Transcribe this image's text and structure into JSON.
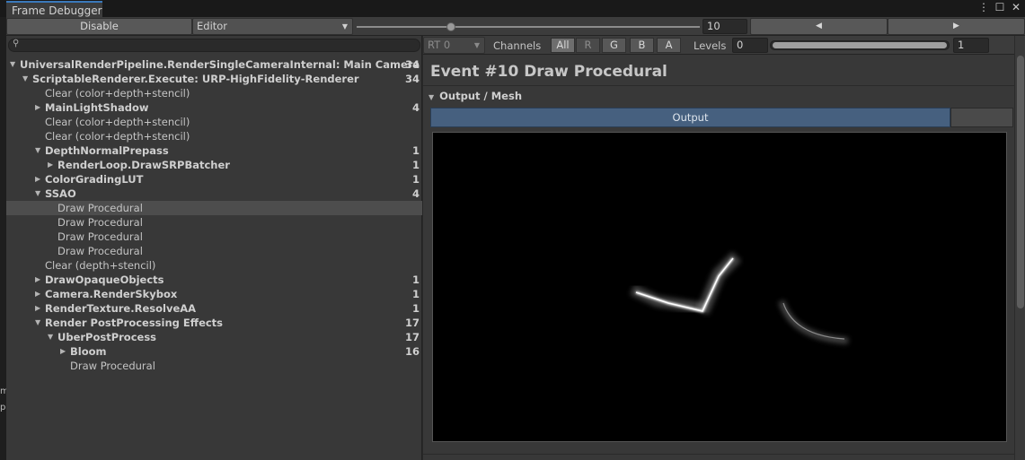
{
  "window": {
    "tab_title": "Frame Debugger",
    "menu_icon": "kebab-menu-icon",
    "maximize_icon": "maximize-icon",
    "close_icon": "close-icon"
  },
  "toolbar": {
    "disable_label": "Disable",
    "target_dropdown": "Editor",
    "event_slider_value": 10,
    "event_number": "10",
    "prev_icon": "triangle-left-icon",
    "next_icon": "triangle-right-icon"
  },
  "left_edge_fragments": [
    "m",
    "p"
  ],
  "hierarchy": {
    "search_placeholder": "",
    "rows": [
      {
        "label": "UniversalRenderPipeline.RenderSingleCameraInternal: Main Camera",
        "count": "34",
        "depth": 0,
        "expander": "expanded",
        "bold": true
      },
      {
        "label": "ScriptableRenderer.Execute: URP-HighFidelity-Renderer",
        "count": "34",
        "depth": 1,
        "expander": "expanded",
        "bold": true
      },
      {
        "label": "Clear (color+depth+stencil)",
        "count": "",
        "depth": 2,
        "expander": "none",
        "bold": false
      },
      {
        "label": "MainLightShadow",
        "count": "4",
        "depth": 2,
        "expander": "collapsed",
        "bold": true
      },
      {
        "label": "Clear (color+depth+stencil)",
        "count": "",
        "depth": 2,
        "expander": "none",
        "bold": false
      },
      {
        "label": "Clear (color+depth+stencil)",
        "count": "",
        "depth": 2,
        "expander": "none",
        "bold": false
      },
      {
        "label": "DepthNormalPrepass",
        "count": "1",
        "depth": 2,
        "expander": "expanded",
        "bold": true
      },
      {
        "label": "RenderLoop.DrawSRPBatcher",
        "count": "1",
        "depth": 3,
        "expander": "collapsed",
        "bold": true
      },
      {
        "label": "ColorGradingLUT",
        "count": "1",
        "depth": 2,
        "expander": "collapsed",
        "bold": true
      },
      {
        "label": "SSAO",
        "count": "4",
        "depth": 2,
        "expander": "expanded",
        "bold": true
      },
      {
        "label": "Draw Procedural",
        "count": "",
        "depth": 3,
        "expander": "none",
        "bold": false,
        "selected": true
      },
      {
        "label": "Draw Procedural",
        "count": "",
        "depth": 3,
        "expander": "none",
        "bold": false
      },
      {
        "label": "Draw Procedural",
        "count": "",
        "depth": 3,
        "expander": "none",
        "bold": false
      },
      {
        "label": "Draw Procedural",
        "count": "",
        "depth": 3,
        "expander": "none",
        "bold": false
      },
      {
        "label": "Clear (depth+stencil)",
        "count": "",
        "depth": 2,
        "expander": "none",
        "bold": false
      },
      {
        "label": "DrawOpaqueObjects",
        "count": "1",
        "depth": 2,
        "expander": "collapsed",
        "bold": true
      },
      {
        "label": "Camera.RenderSkybox",
        "count": "1",
        "depth": 2,
        "expander": "collapsed",
        "bold": true
      },
      {
        "label": "RenderTexture.ResolveAA",
        "count": "1",
        "depth": 2,
        "expander": "collapsed",
        "bold": true
      },
      {
        "label": "Render PostProcessing Effects",
        "count": "17",
        "depth": 2,
        "expander": "expanded",
        "bold": true
      },
      {
        "label": "UberPostProcess",
        "count": "17",
        "depth": 3,
        "expander": "expanded",
        "bold": true
      },
      {
        "label": "Bloom",
        "count": "16",
        "depth": 4,
        "expander": "collapsed",
        "bold": true
      },
      {
        "label": "Draw Procedural",
        "count": "",
        "depth": 4,
        "expander": "none",
        "bold": false
      }
    ]
  },
  "render_target": {
    "rt_dropdown": "RT 0",
    "channels_label": "Channels",
    "channels": [
      {
        "label": "All",
        "state": "active"
      },
      {
        "label": "R",
        "state": "dim"
      },
      {
        "label": "G",
        "state": "normal"
      },
      {
        "label": "B",
        "state": "normal"
      },
      {
        "label": "A",
        "state": "normal"
      }
    ],
    "levels_label": "Levels",
    "levels_min": "0",
    "levels_max": "1",
    "levels_slider_fraction": 1.0
  },
  "details": {
    "event_title": "Event #10 Draw Procedural",
    "section_title": "Output / Mesh",
    "output_tab_label": "Output"
  },
  "colors": {
    "selection_row": "#4d4d4d",
    "output_tab": "#46607f",
    "tab_highlight": "#3a79bb"
  }
}
